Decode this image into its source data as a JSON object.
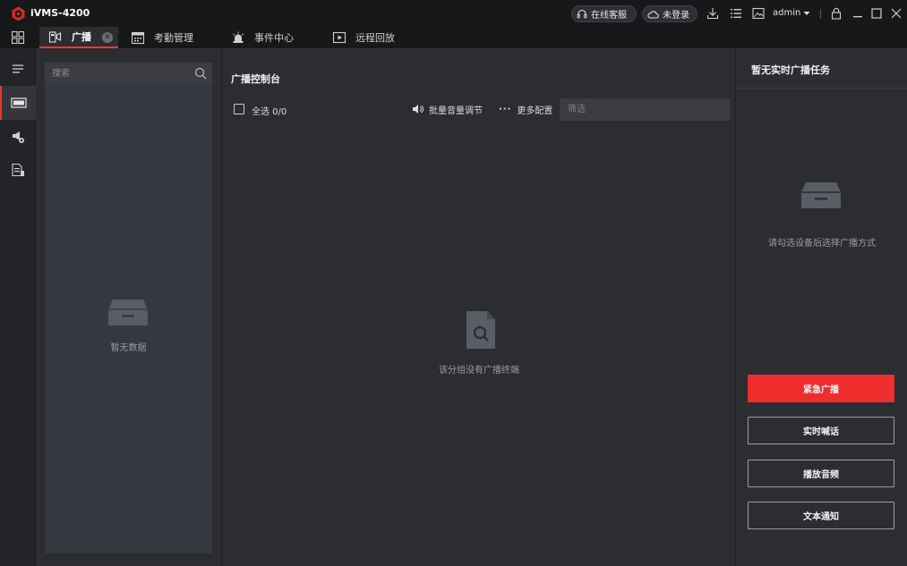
{
  "app": {
    "title": "iVMS-4200",
    "brand_color": "#e8392f"
  },
  "titlebar": {
    "service_label": "在线客服",
    "login_label": "未登录",
    "user": "admin",
    "icons": [
      "headset-icon",
      "cloud-icon",
      "download-icon",
      "list-icon",
      "image-icon",
      "lock-icon",
      "minimize-icon",
      "maximize-icon",
      "close-icon"
    ]
  },
  "tabs": [
    {
      "label": "广播",
      "active": true,
      "icon": "broadcast-icon"
    },
    {
      "label": "考勤管理",
      "active": false,
      "icon": "calendar-icon"
    },
    {
      "label": "事件中心",
      "active": false,
      "icon": "alarm-icon"
    },
    {
      "label": "远程回放",
      "active": false,
      "icon": "playback-icon"
    }
  ],
  "navstrip": {
    "icons": [
      "menu-icon",
      "broadcast-device-icon",
      "speaker-icon",
      "document-icon"
    ]
  },
  "device_panel": {
    "search_placeholder": "搜索",
    "empty_text": "暂无数据"
  },
  "console": {
    "title": "广播控制台",
    "select_all": "全选 0/0",
    "volume_label": "批量音量调节",
    "more_label": "更多配置",
    "filter_placeholder": "筛选",
    "empty_text": "该分组没有广播终端"
  },
  "right_panel": {
    "title": "暂无实时广播任务",
    "hint": "请勾选设备后选择广播方式",
    "buttons": {
      "emergency": "紧急广播",
      "talk": "实时喊话",
      "audio": "播放音频",
      "text": "文本通知"
    },
    "accent": "#ee2d2d"
  }
}
